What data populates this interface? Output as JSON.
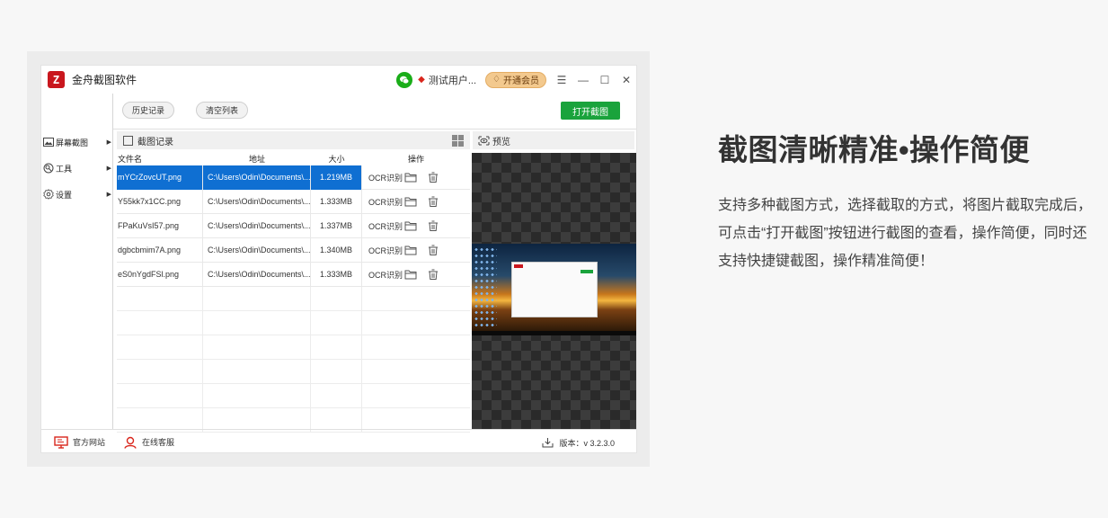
{
  "app": {
    "title": "金舟截图软件",
    "logo_glyph": "Z",
    "user_name": "测试用户...",
    "vip_label": "开通会员",
    "menu_glyph": "☰",
    "minimize_glyph": "—",
    "maximize_glyph": "☐",
    "close_glyph": "✕"
  },
  "sidebar": {
    "items": [
      {
        "label": "屏幕截图",
        "icon": "image-icon"
      },
      {
        "label": "工具",
        "icon": "tools-icon"
      },
      {
        "label": "设置",
        "icon": "gear-icon"
      }
    ],
    "caret": "▶"
  },
  "toolbar": {
    "history_label": "历史记录",
    "clear_label": "清空列表",
    "open_label": "打开截图"
  },
  "list": {
    "title": "截图记录",
    "columns": [
      "文件名",
      "地址",
      "大小",
      "操作"
    ],
    "rows": [
      {
        "name": "mYCrZovcUT.png",
        "path": "C:\\Users\\Odin\\Documents\\...",
        "size": "1.219MB",
        "action": "OCR识别",
        "selected": true
      },
      {
        "name": "Y55kk7x1CC.png",
        "path": "C:\\Users\\Odin\\Documents\\...",
        "size": "1.333MB",
        "action": "OCR识别",
        "selected": false
      },
      {
        "name": "FPaKuVsI57.png",
        "path": "C:\\Users\\Odin\\Documents\\...",
        "size": "1.337MB",
        "action": "OCR识别",
        "selected": false
      },
      {
        "name": "dgbcbmim7A.png",
        "path": "C:\\Users\\Odin\\Documents\\...",
        "size": "1.340MB",
        "action": "OCR识别",
        "selected": false
      },
      {
        "name": "eS0nYgdFSl.png",
        "path": "C:\\Users\\Odin\\Documents\\...",
        "size": "1.333MB",
        "action": "OCR识别",
        "selected": false
      }
    ]
  },
  "preview": {
    "title": "预览"
  },
  "footer": {
    "website_label": "官方网站",
    "service_label": "在线客服",
    "version_label": "版本：v 3.2.3.0"
  },
  "copy": {
    "headline": "截图清晰精准•操作简便",
    "description": "支持多种截图方式，选择截取的方式，将图片截取完成后，可点击“打开截图”按钮进行截图的查看，操作简便，同时还支持快捷键截图，操作精准简便！"
  },
  "colors": {
    "accent_green": "#1aa33c",
    "selection_blue": "#0f6fd2",
    "brand_red": "#c9171e",
    "vip_gold": "#f3c98e"
  }
}
